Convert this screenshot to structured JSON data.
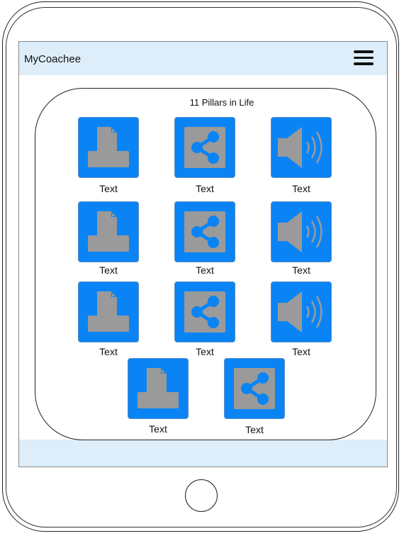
{
  "header": {
    "title": "MyCoachee",
    "menu_icon": "hamburger-menu-icon"
  },
  "panel": {
    "title": "11 Pillars in Life"
  },
  "tiles": [
    {
      "label": "Text",
      "icon": "print-icon"
    },
    {
      "label": "Text",
      "icon": "share-icon"
    },
    {
      "label": "Text",
      "icon": "speaker-icon"
    },
    {
      "label": "Text",
      "icon": "print-icon"
    },
    {
      "label": "Text",
      "icon": "share-icon"
    },
    {
      "label": "Text",
      "icon": "speaker-icon"
    },
    {
      "label": "Text",
      "icon": "print-icon"
    },
    {
      "label": "Text",
      "icon": "share-icon"
    },
    {
      "label": "Text",
      "icon": "speaker-icon"
    },
    {
      "label": "Text",
      "icon": "print-icon"
    },
    {
      "label": "Text",
      "icon": "share-icon"
    }
  ],
  "colors": {
    "tile_blue": "#0a84f5",
    "icon_gray": "#999999",
    "header_bg": "#ddeefa"
  }
}
